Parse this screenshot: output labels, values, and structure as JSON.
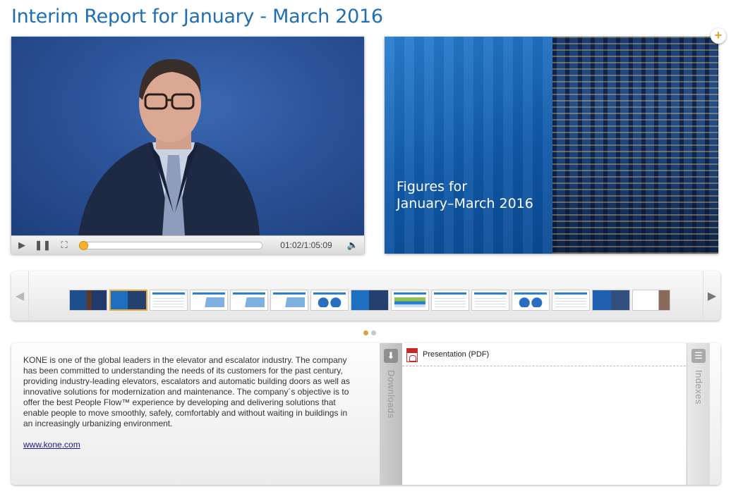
{
  "page": {
    "title": "Interim Report for January - March 2016"
  },
  "player": {
    "current_time": "01:02",
    "separator": "/",
    "duration": "1:05:09",
    "progress_fraction": 0.016
  },
  "slide": {
    "line1": "Figures for",
    "line2": "January–March 2016"
  },
  "thumbnails": {
    "count": 16,
    "active_index": 1,
    "styles": [
      "photo",
      "blue",
      "doc",
      "chart",
      "chart",
      "chart",
      "pie",
      "blue",
      "green",
      "doc",
      "doc",
      "pie",
      "doc",
      "photo-blue",
      "sketch"
    ]
  },
  "pager": {
    "active_color": "#e0a23a",
    "inactive_color": "#c8c8c8"
  },
  "description": {
    "text": "KONE is one of the global leaders in the elevator and escalator industry. The company has been committed to understanding the needs of its customers for the past century, providing industry-leading elevators, escalators and automatic building doors as well as innovative solutions for modernization and maintenance. The company´s objective is to offer the best People Flow™ experience by developing and delivering solutions that enable people to move smoothly, safely, comfortably and without waiting in buildings in an increasingly urbanizing environment.",
    "link": "www.kone.com"
  },
  "tabs": {
    "downloads": "Downloads",
    "indexes": "Indexes"
  },
  "downloads": [
    {
      "label": "Presentation (PDF)",
      "icon": "pdf-icon"
    }
  ],
  "colors": {
    "title": "#1f6fb5",
    "accent": "#f1ad22"
  }
}
